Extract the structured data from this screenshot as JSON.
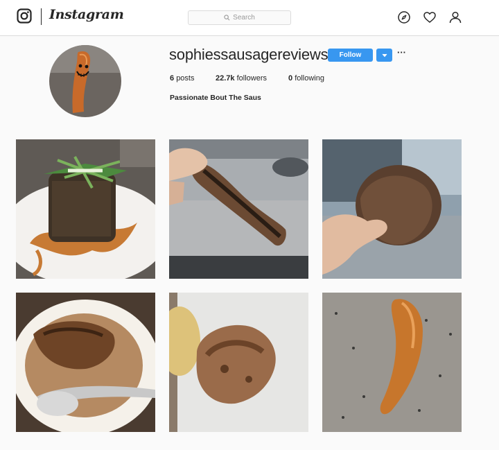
{
  "header": {
    "brand": "Instagram",
    "search_placeholder": "Search",
    "icons": [
      "instagram-glyph-icon",
      "search-icon",
      "compass-icon",
      "heart-icon",
      "person-icon"
    ]
  },
  "profile": {
    "username": "sophiessausagereviews",
    "follow_label": "Follow",
    "more_label": "···",
    "stats": {
      "posts": {
        "count": "6",
        "label": "posts"
      },
      "followers": {
        "count": "22.7k",
        "label": "followers"
      },
      "following": {
        "count": "0",
        "label": "following"
      }
    },
    "bio": "Passionate Bout The Saus"
  },
  "colors": {
    "accent": "#3897f0",
    "text": "#262626",
    "border": "#dbdbdb",
    "background": "#fafafa"
  }
}
